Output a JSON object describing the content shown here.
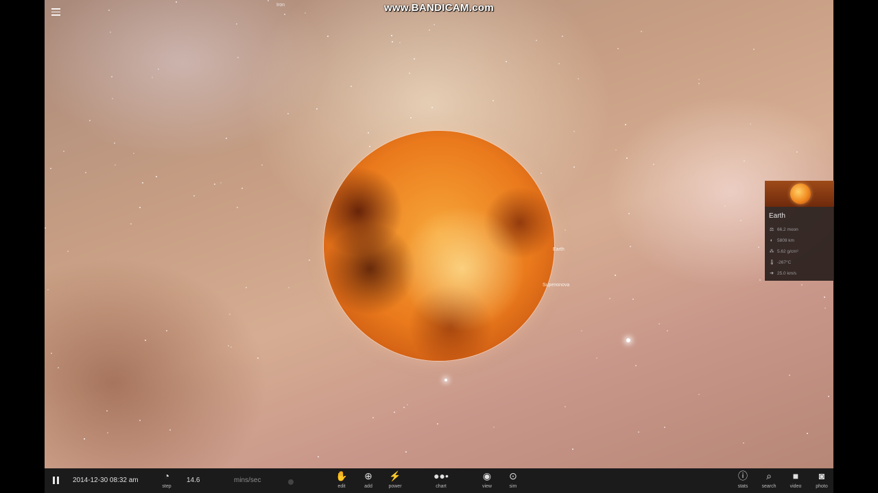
{
  "watermark": "www.BANDICAM.com",
  "top_label": "Iron",
  "scene": {
    "orbit_labels": [
      "Earth",
      "Superionova"
    ]
  },
  "info_panel": {
    "title": "Earth",
    "stats": [
      {
        "icon": "mass-icon",
        "glyph": "⚖",
        "value": "66.2 moon"
      },
      {
        "icon": "radius-icon",
        "glyph": "◐",
        "value": "5809 km"
      },
      {
        "icon": "density-icon",
        "glyph": "⁂",
        "value": "5.62 g/cm³"
      },
      {
        "icon": "temperature-icon",
        "glyph": "🌡",
        "value": "-267°C"
      },
      {
        "icon": "velocity-icon",
        "glyph": "➔",
        "value": "25.0 km/s"
      }
    ]
  },
  "toolbar": {
    "date": "2014-12-30 08:32 am",
    "step_label": "step",
    "speed_value": "14.6",
    "speed_units": "mins/sec",
    "buttons": {
      "edit": "edit",
      "add": "add",
      "power": "power",
      "chart": "chart",
      "view": "view",
      "sim": "sim",
      "stats": "stats",
      "search": "search",
      "video": "video",
      "photo": "photo"
    }
  },
  "colors": {
    "toolbar_bg": "#1b1b1b",
    "panel_bg": "#28201e",
    "planet_orange": "#ea7a1c"
  }
}
